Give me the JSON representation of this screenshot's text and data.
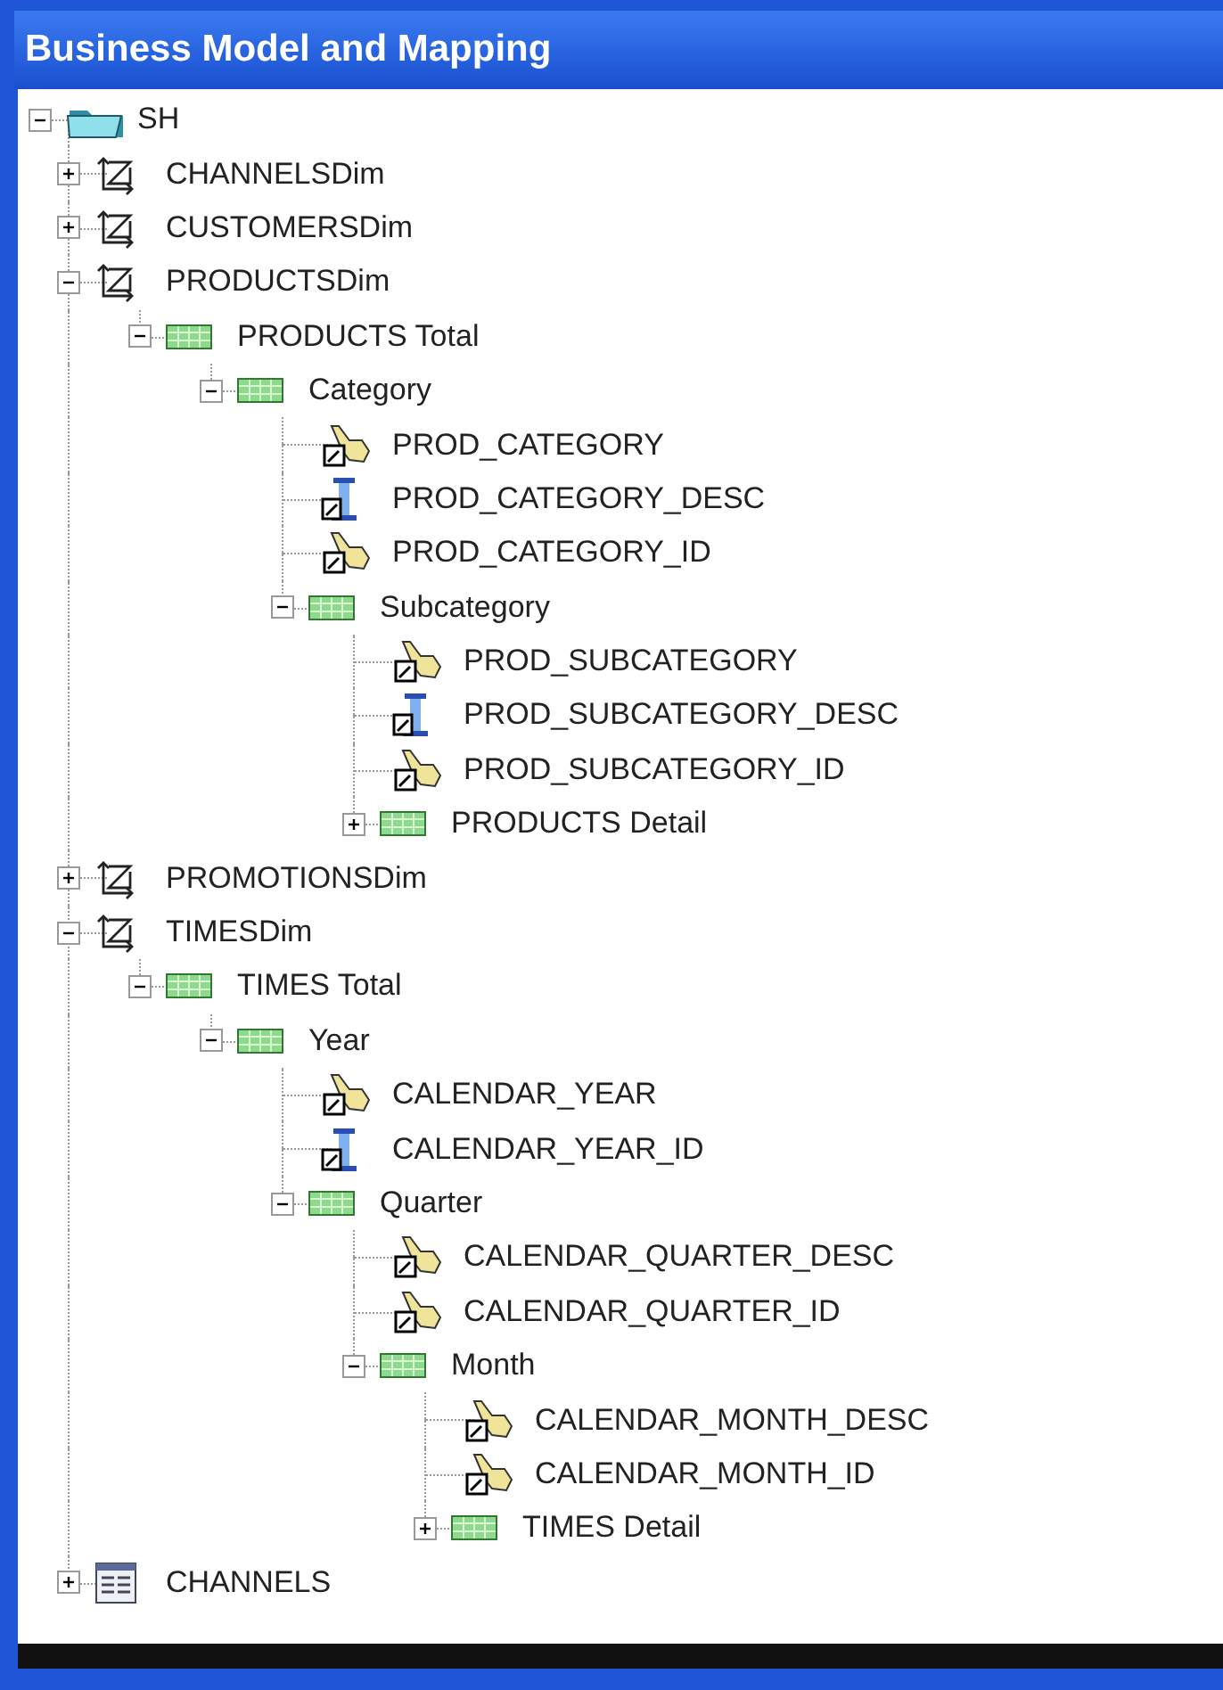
{
  "window": {
    "title": "Business Model and Mapping"
  },
  "tree": [
    {
      "label": "SH",
      "kind": "folder",
      "expanded": true,
      "children": [
        {
          "label": "CHANNELSDim",
          "kind": "dimension",
          "expanded": false
        },
        {
          "label": "CUSTOMERSDim",
          "kind": "dimension",
          "expanded": false
        },
        {
          "label": "PRODUCTSDim",
          "kind": "dimension",
          "expanded": true,
          "children": [
            {
              "label": "PRODUCTS Total",
              "kind": "level",
              "expanded": true,
              "children": [
                {
                  "label": "Category",
                  "kind": "level",
                  "expanded": true,
                  "children": [
                    {
                      "label": "PROD_CATEGORY",
                      "kind": "key"
                    },
                    {
                      "label": "PROD_CATEGORY_DESC",
                      "kind": "column"
                    },
                    {
                      "label": "PROD_CATEGORY_ID",
                      "kind": "key"
                    },
                    {
                      "label": "Subcategory",
                      "kind": "level",
                      "expanded": true,
                      "children": [
                        {
                          "label": "PROD_SUBCATEGORY",
                          "kind": "key"
                        },
                        {
                          "label": "PROD_SUBCATEGORY_DESC",
                          "kind": "column"
                        },
                        {
                          "label": "PROD_SUBCATEGORY_ID",
                          "kind": "key"
                        },
                        {
                          "label": "PRODUCTS Detail",
                          "kind": "level",
                          "expanded": false
                        }
                      ]
                    }
                  ]
                }
              ]
            }
          ]
        },
        {
          "label": "PROMOTIONSDim",
          "kind": "dimension",
          "expanded": false
        },
        {
          "label": "TIMESDim",
          "kind": "dimension",
          "expanded": true,
          "children": [
            {
              "label": "TIMES Total",
              "kind": "level",
              "expanded": true,
              "children": [
                {
                  "label": "Year",
                  "kind": "level",
                  "expanded": true,
                  "children": [
                    {
                      "label": "CALENDAR_YEAR",
                      "kind": "key"
                    },
                    {
                      "label": "CALENDAR_YEAR_ID",
                      "kind": "column"
                    },
                    {
                      "label": "Quarter",
                      "kind": "level",
                      "expanded": true,
                      "children": [
                        {
                          "label": "CALENDAR_QUARTER_DESC",
                          "kind": "key"
                        },
                        {
                          "label": "CALENDAR_QUARTER_ID",
                          "kind": "key"
                        },
                        {
                          "label": "Month",
                          "kind": "level",
                          "expanded": true,
                          "children": [
                            {
                              "label": "CALENDAR_MONTH_DESC",
                              "kind": "key"
                            },
                            {
                              "label": "CALENDAR_MONTH_ID",
                              "kind": "key"
                            },
                            {
                              "label": "TIMES Detail",
                              "kind": "level",
                              "expanded": false
                            }
                          ]
                        }
                      ]
                    }
                  ]
                }
              ]
            }
          ]
        },
        {
          "label": "CHANNELS",
          "kind": "table",
          "expanded": false
        }
      ]
    }
  ]
}
